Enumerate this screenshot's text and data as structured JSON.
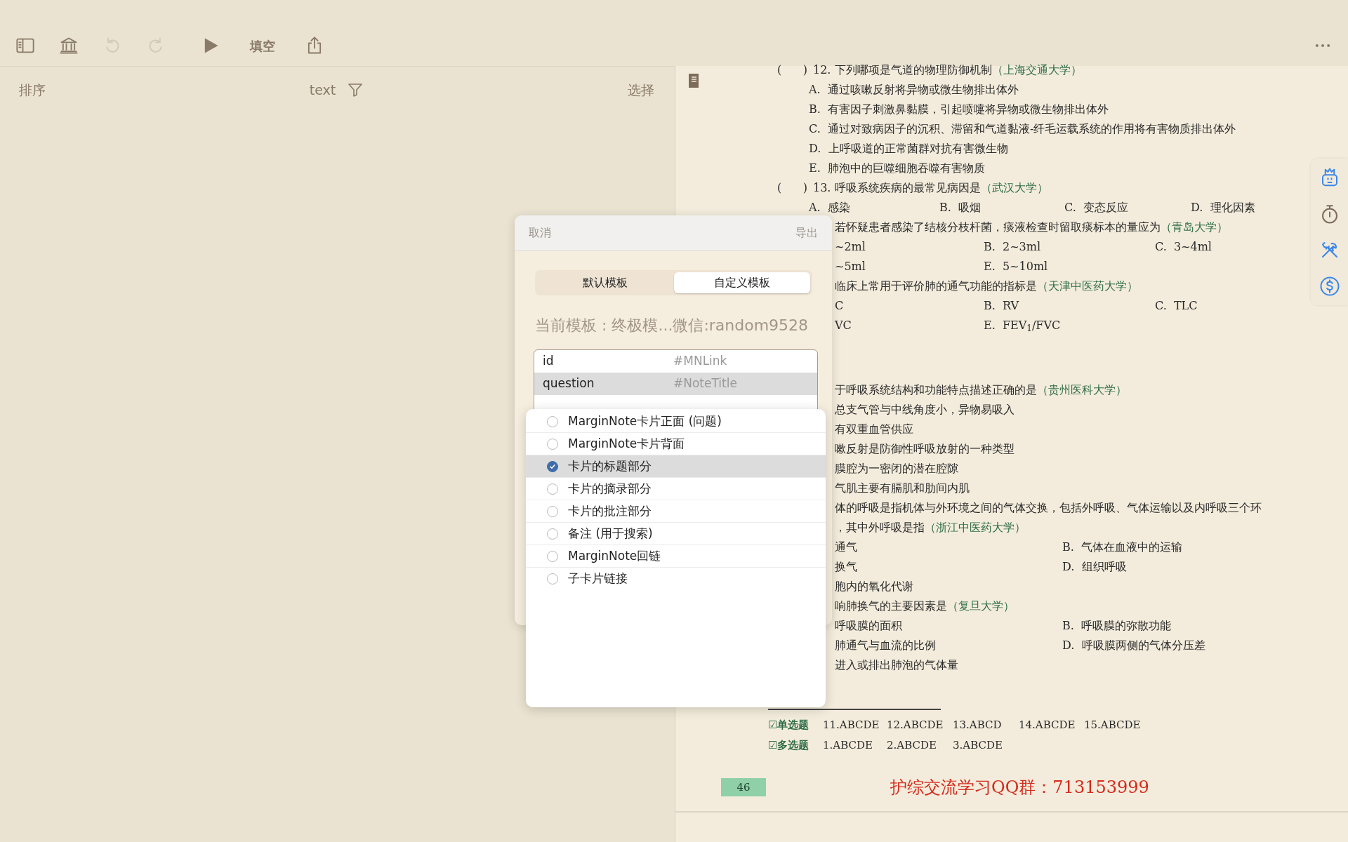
{
  "toolbar": {
    "items": [
      {
        "kind": "sidebar",
        "disabled": false
      },
      {
        "kind": "library",
        "disabled": false
      },
      {
        "kind": "undo",
        "disabled": true
      },
      {
        "kind": "redo",
        "disabled": true
      },
      {
        "kind": "play",
        "disabled": false
      },
      {
        "kind": "text",
        "label": "填空",
        "disabled": false
      },
      {
        "kind": "share",
        "disabled": false
      },
      {
        "kind": "more",
        "disabled": false
      }
    ]
  },
  "list_header": {
    "sort": "排序",
    "filter_text": "text",
    "select": "选择"
  },
  "document": {
    "blocks": [
      {
        "lines": [
          {
            "kind": "question",
            "bracket": "(      )",
            "text": "12. 下列哪项是气道的物理防御机制",
            "source": "（上海交通大学）"
          },
          {
            "kind": "opt1",
            "cells": [
              "A.  通过咳嗽反射将异物或微生物排出体外"
            ]
          },
          {
            "kind": "opt1",
            "cells": [
              "B.  有害因子刺激鼻黏膜，引起喷嚏将异物或微生物排出体外"
            ]
          },
          {
            "kind": "opt1",
            "cells": [
              "C.  通过对致病因子的沉积、滞留和气道黏液-纤毛运载系统的作用将有害物质排出体外"
            ]
          },
          {
            "kind": "opt1",
            "cells": [
              "D.  上呼吸道的正常菌群对抗有害微生物"
            ]
          },
          {
            "kind": "opt1",
            "cells": [
              "E.  肺泡中的巨噬细胞吞噬有害物质"
            ]
          },
          {
            "kind": "question",
            "bracket": "(      )",
            "text": "13. 呼吸系统疾病的最常见病因是",
            "source": "（武汉大学）"
          },
          {
            "kind": "opts4",
            "cells": [
              "A.  感染",
              "B.  吸烟",
              "C.  变态反应",
              "D.  理化因素"
            ]
          },
          {
            "kind": "tail",
            "text": "若怀疑患者感染了结核分枝杆菌，痰液检查时留取痰标本的量应为",
            "source": "（青岛大学）"
          },
          {
            "kind": "tail3",
            "cells": [
              "~2ml",
              "B.  2~3ml",
              "C.  3~4ml"
            ]
          },
          {
            "kind": "tail3",
            "cells": [
              "~5ml",
              "E.  5~10ml"
            ]
          },
          {
            "kind": "tail",
            "text": "临床上常用于评价肺的通气功能的指标是",
            "source": "（天津中医药大学）"
          },
          {
            "kind": "tail3",
            "cells": [
              "C",
              "B.  RV",
              "C.  TLC"
            ]
          },
          {
            "kind": "tail3",
            "cells": [
              "VC",
              "E.  FEV$_{1}$/FVC"
            ]
          }
        ]
      },
      {
        "lines": [
          {
            "kind": "tail",
            "text": "于呼吸系统结构和功能特点描述正确的是",
            "source": "（贵州医科大学）"
          },
          {
            "kind": "tail",
            "text": "总支气管与中线角度小，异物易吸入"
          },
          {
            "kind": "tail",
            "text": "有双重血管供应"
          },
          {
            "kind": "tail",
            "text": "嗽反射是防御性呼吸放射的一种类型"
          },
          {
            "kind": "tail",
            "text": "膜腔为一密闭的潜在腔隙"
          },
          {
            "kind": "tail",
            "text": "气肌主要有膈肌和肋间内肌"
          },
          {
            "kind": "tail",
            "text": "体的呼吸是指机体与外环境之间的气体交换，包括外呼吸、气体运输以及内呼吸三个环"
          },
          {
            "kind": "tail",
            "text": "，其中外呼吸是指",
            "source": "（浙江中医药大学）"
          },
          {
            "kind": "tail2",
            "cells": [
              "通气",
              "B.  气体在血液中的运输"
            ]
          },
          {
            "kind": "tail2",
            "cells": [
              "换气",
              "D.  组织呼吸"
            ]
          },
          {
            "kind": "tail",
            "text": "胞内的氧化代谢"
          },
          {
            "kind": "tail",
            "text": "响肺换气的主要因素是",
            "source": "（复旦大学）"
          },
          {
            "kind": "tail2",
            "cells": [
              "呼吸膜的面积",
              "B.  呼吸膜的弥散功能"
            ]
          },
          {
            "kind": "tail2",
            "cells": [
              "肺通气与血流的比例",
              "D.  呼吸膜两侧的气体分压差"
            ]
          },
          {
            "kind": "tail",
            "text": "进入或排出肺泡的气体量"
          }
        ]
      }
    ],
    "answers": [
      {
        "label": "☑单选题",
        "items": [
          "11.ABCDE",
          "12.ABCDE",
          "13.ABCD",
          "14.ABCDE",
          "15.ABCDE"
        ]
      },
      {
        "label": "☑多选题",
        "items": [
          "1.ABCDE",
          "2.ABCDE",
          "3.ABCDE"
        ]
      }
    ],
    "page_number": "46",
    "footer": "护综交流学习QQ群：713153999"
  },
  "side_tools": [
    {
      "kind": "robot"
    },
    {
      "kind": "timer"
    },
    {
      "kind": "tools"
    },
    {
      "kind": "dollar"
    }
  ],
  "dialog": {
    "cancel": "取消",
    "export": "导出",
    "segments": [
      {
        "label": "默认模板",
        "selected": false
      },
      {
        "label": "自定义模板",
        "selected": true
      }
    ],
    "current_template": "当前模板 : 终极模...微信:random9528",
    "fields": [
      {
        "name": "id",
        "value": "#MNLink",
        "selected": false
      },
      {
        "name": "question",
        "value": "#NoteTitle",
        "selected": true
      }
    ],
    "options": [
      {
        "label": "MarginNote卡片正面 (问题)",
        "selected": false
      },
      {
        "label": "MarginNote卡片背面",
        "selected": false
      },
      {
        "label": "卡片的标题部分",
        "selected": true
      },
      {
        "label": "卡片的摘录部分",
        "selected": false
      },
      {
        "label": "卡片的批注部分",
        "selected": false
      },
      {
        "label": "备注 (用于搜索)",
        "selected": false
      },
      {
        "label": "MarginNote回链",
        "selected": false
      },
      {
        "label": "子卡片链接",
        "selected": false
      }
    ]
  }
}
